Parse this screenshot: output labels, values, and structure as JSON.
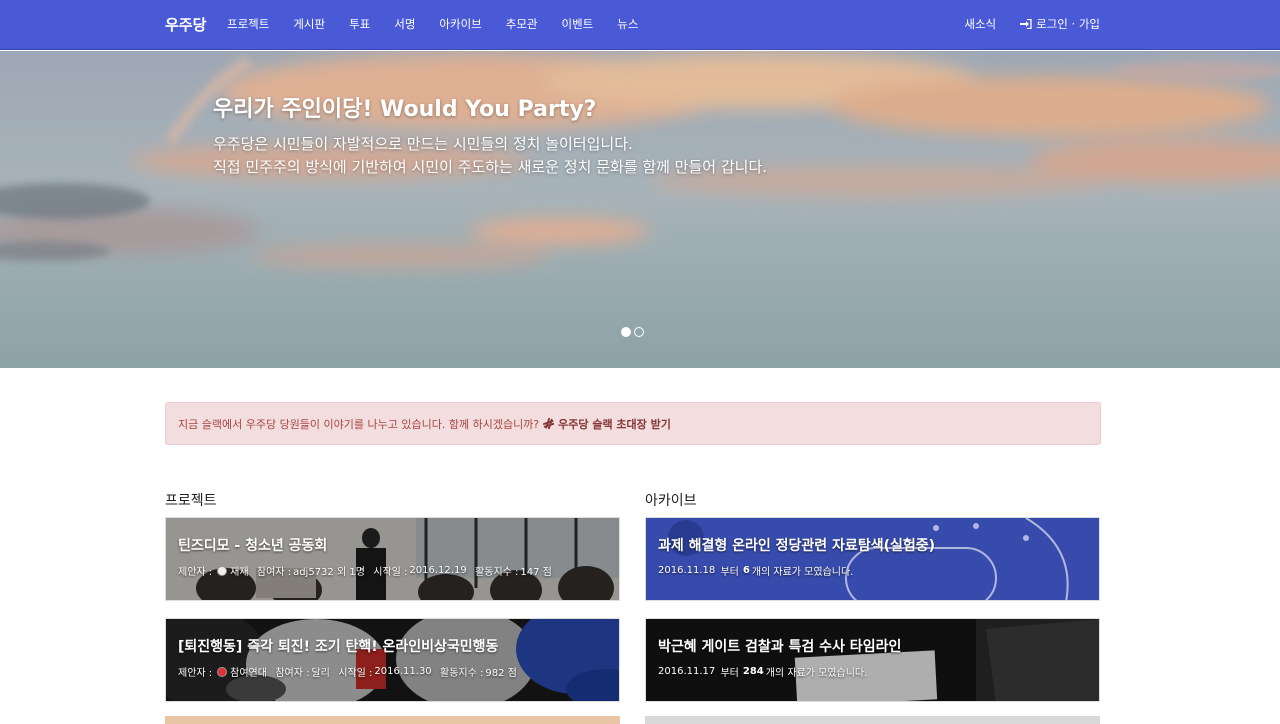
{
  "navbar": {
    "brand": "우주당",
    "links": [
      "프로젝트",
      "게시판",
      "투표",
      "서명",
      "아카이브",
      "추모관",
      "이벤트",
      "뉴스"
    ],
    "news_label": "새소식",
    "login_label": "로그인 · 가입",
    "bg_color": "#4a5ad6"
  },
  "hero": {
    "title": "우리가 주인이당! Would You Party?",
    "line1": "우주당은 시민들이 자발적으로 만드는 시민들의 정치 놀이터입니다.",
    "line2": "직접 민주주의 방식에 기반하여 시민이 주도하는 새로운 정치 문화를 함께 만들어 갑니다.",
    "slides": 2,
    "active_slide": 1
  },
  "alert": {
    "text": "지금 슬랙에서 우주당 당원들이 이야기를 나누고 있습니다. 함께 하시겠습니까?",
    "link": "우주당 슬랙 초대장 받기",
    "icon": "slack-icon"
  },
  "projects": {
    "title": "프로젝트",
    "items": [
      {
        "title": "틴즈디모 - 청소년 공동회",
        "proposer_label": "제안자 :",
        "proposer": "재재",
        "participant_label": "참여자 :",
        "participant": "adj5732 외 1명",
        "start_label": "시작일 :",
        "start": "2016.12.19",
        "activity_label": "활동지수 :",
        "activity": "147 점"
      },
      {
        "title": "[퇴진행동] 즉각 퇴진! 조기 탄핵! 온라인비상국민행동",
        "proposer_label": "제안자 :",
        "proposer": "참여연대",
        "participant_label": "참여자 :",
        "participant": "달리",
        "start_label": "시작일 :",
        "start": "2016.11.30",
        "activity_label": "활동지수 :",
        "activity": "982 점"
      }
    ]
  },
  "archive": {
    "title": "아카이브",
    "items": [
      {
        "title": "과제 해결형 온라인 정당관련 자료탐색(실험중)",
        "date": "2016.11.18",
        "mid": "부터",
        "count": "6",
        "tail": "개의 자료가 모였습니다."
      },
      {
        "title": "박근혜 게이트 검찰과 특검 수사 타임라인",
        "date": "2016.11.17",
        "mid": "부터",
        "count": "284",
        "tail": "개의 자료가 모였습니다."
      }
    ]
  }
}
